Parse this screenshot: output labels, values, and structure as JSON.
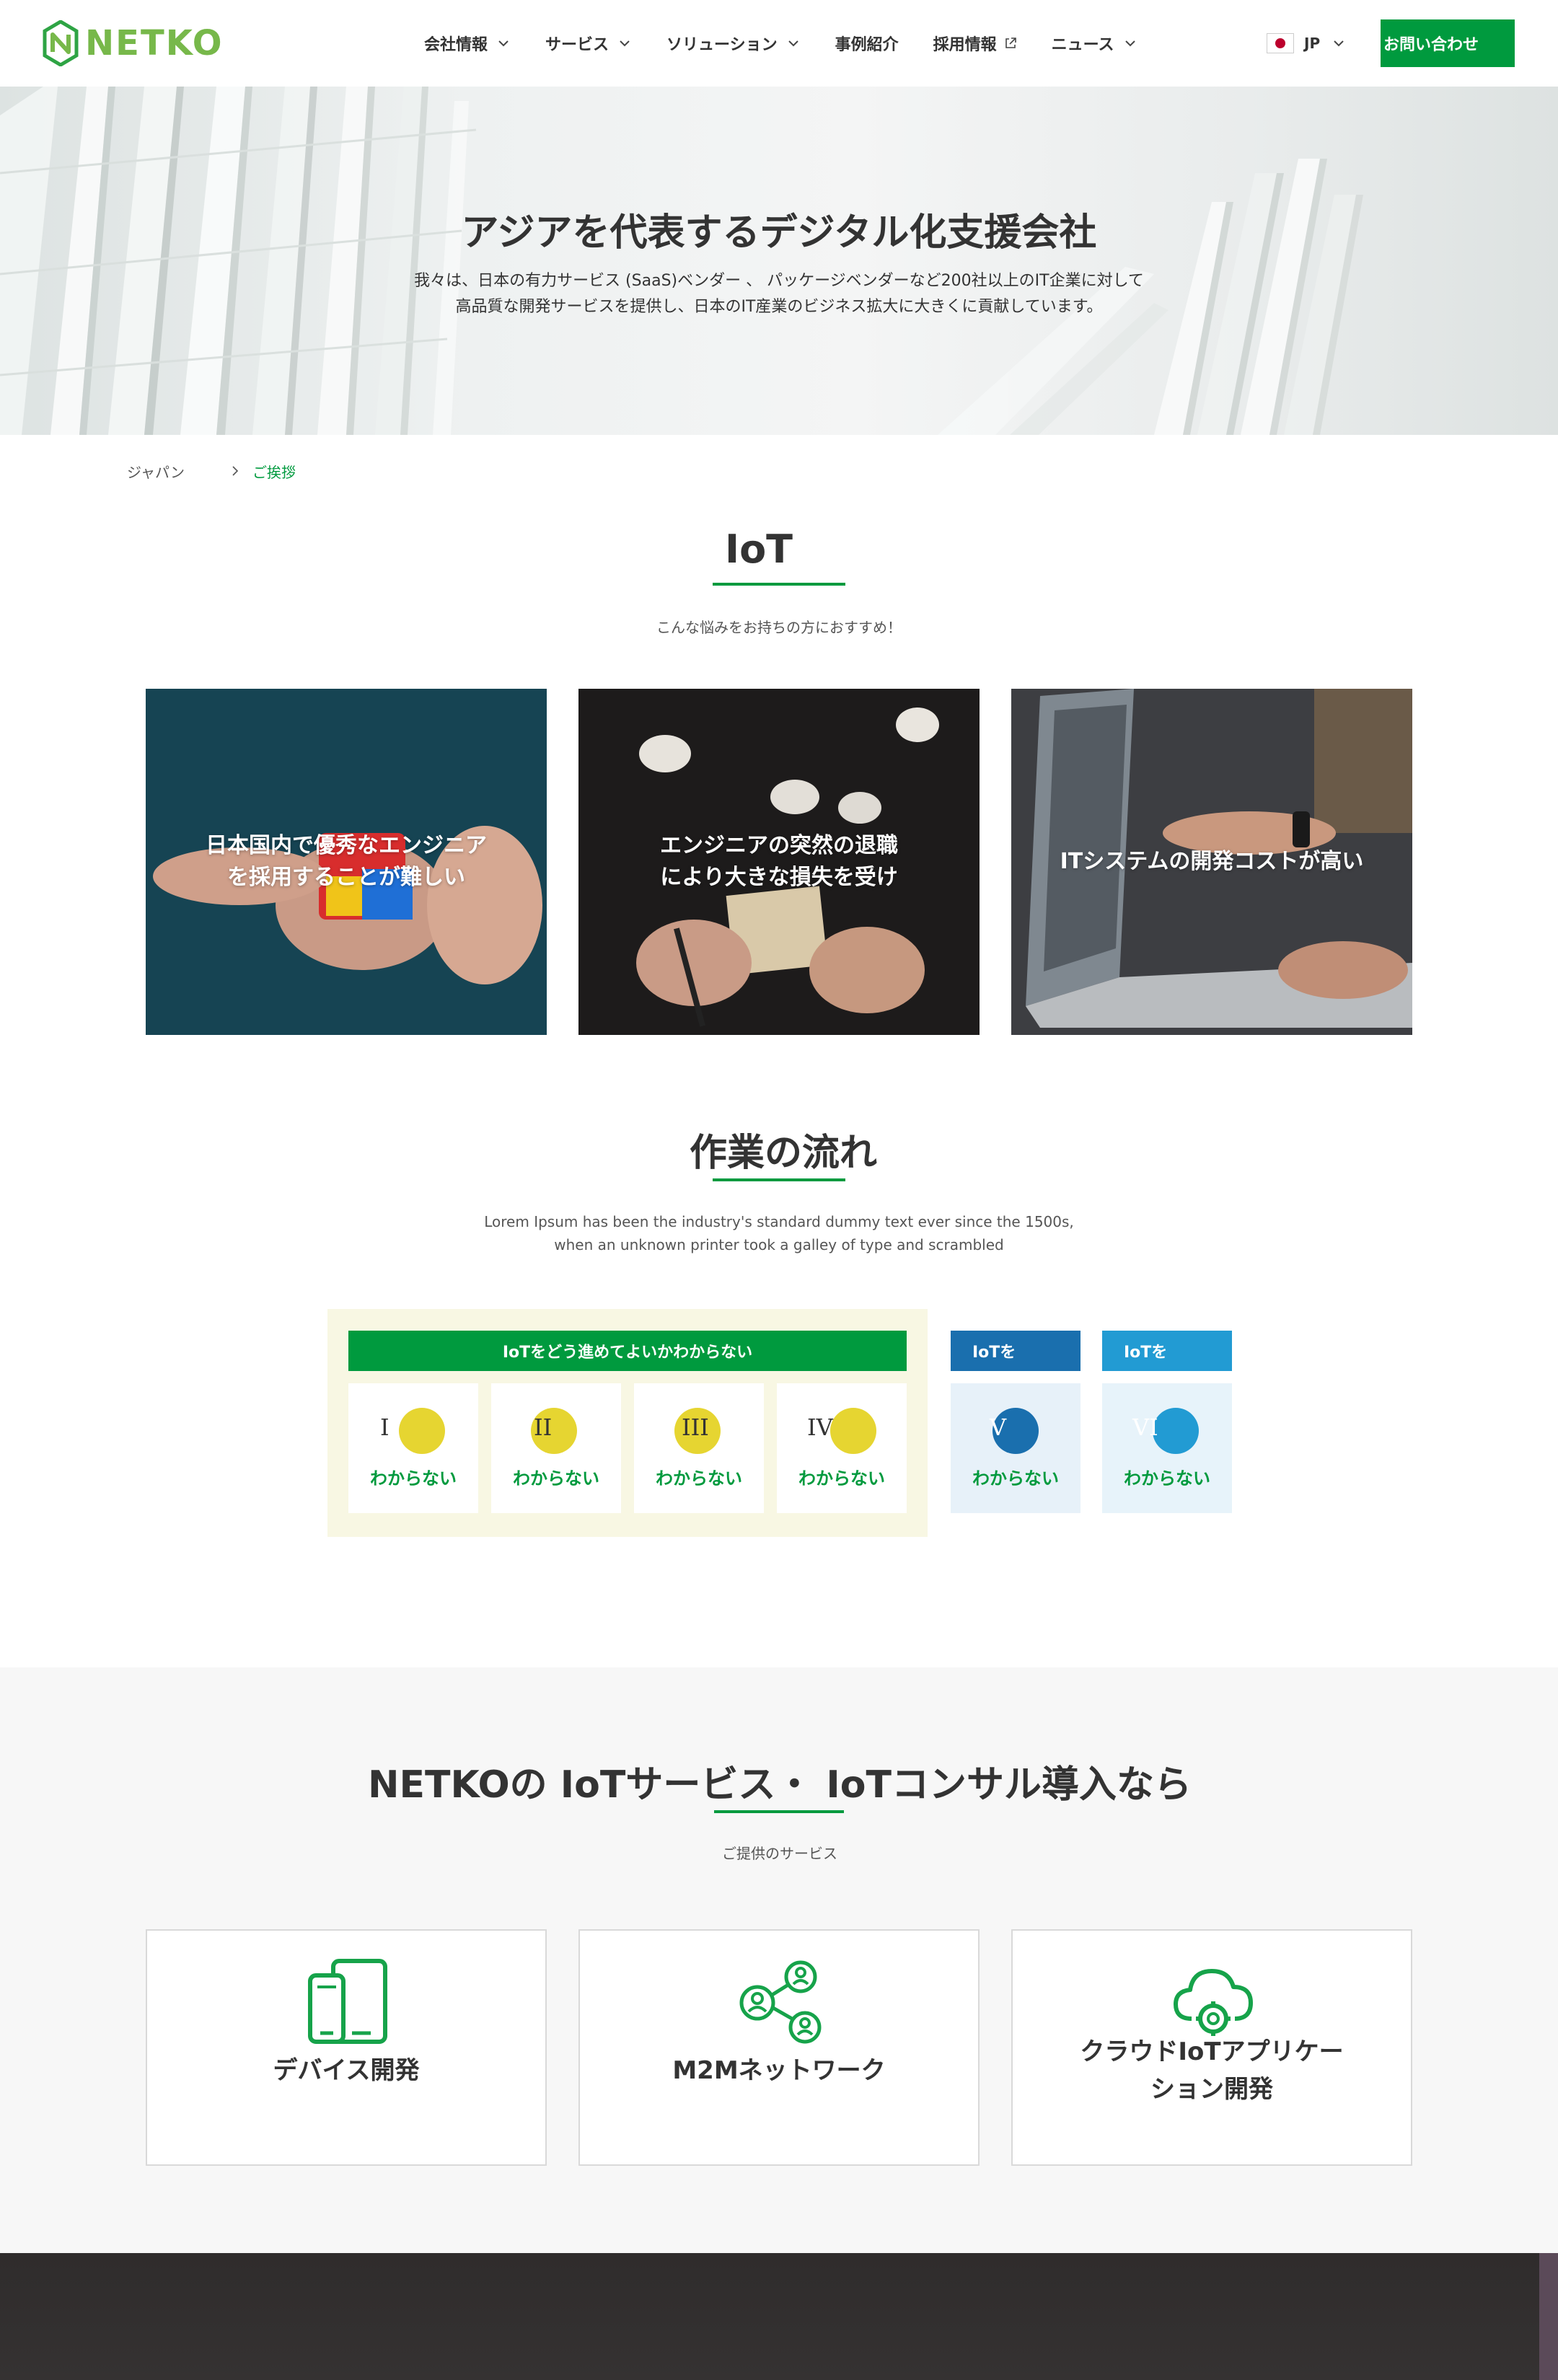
{
  "header": {
    "logo_text": "NETKO",
    "nav": [
      {
        "label": "会社情報",
        "has_dropdown": true
      },
      {
        "label": "サービス",
        "has_dropdown": true
      },
      {
        "label": "ソリューション",
        "has_dropdown": true
      },
      {
        "label": "事例紹介",
        "has_dropdown": false
      },
      {
        "label": "採用情報",
        "external": true
      },
      {
        "label": "ニュース",
        "has_dropdown": true
      }
    ],
    "lang_label": "JP",
    "contact_label": "お問い合わせ"
  },
  "hero": {
    "title": "アジアを代表するデジタル化支援会社",
    "desc_line1": "我々は、日本の有力サービス (SaaS)ベンダー 、 パッケージベンダーなど200社以上のIT企業に対して",
    "desc_line2": "高品質な開発サービスを提供し、日本のIT産業のビジネス拡大に大きくに貢献しています。"
  },
  "breadcrumb": {
    "home": "ジャパン",
    "current": "ご挨拶"
  },
  "iot": {
    "title": "IoT",
    "subtitle": "こんな悩みをお持ちの方におすすめ！",
    "cards": [
      {
        "text": "日本国内で優秀なエンジニア\nを採用することが難しい"
      },
      {
        "text": "エンジニアの突然の退職\nにより大きな損失を受け"
      },
      {
        "text": "ITシステムの開発コストが高い"
      }
    ]
  },
  "flow": {
    "title": "作業の流れ",
    "desc_line1": "Lorem Ipsum has been the industry's standard dummy text ever since the 1500s,",
    "desc_line2": "when an unknown printer took a galley of type and scrambled",
    "group_header": "IoTをどう進めてよいかわからない",
    "header_5": "IoTを",
    "header_6": "IoTを",
    "steps": [
      {
        "num": "I",
        "label": "わからない"
      },
      {
        "num": "II",
        "label": "わからない"
      },
      {
        "num": "III",
        "label": "わからない"
      },
      {
        "num": "IV",
        "label": "わからない"
      },
      {
        "num": "V",
        "label": "わからない"
      },
      {
        "num": "VI",
        "label": "わからない"
      }
    ],
    "colors": {
      "green": "#009a3e",
      "yellow": "#e6d531",
      "blue": "#1a6fae",
      "lightblue": "#229bd3"
    }
  },
  "services": {
    "title": "NETKOの IoTサービス・ IoTコンサル導入なら",
    "subtitle": "ご提供のサービス",
    "cards": [
      {
        "icon": "devices-icon",
        "label": "デバイス開発"
      },
      {
        "icon": "network-icon",
        "label": "M2Mネットワーク"
      },
      {
        "icon": "cloud-gear-icon",
        "label": "クラウドIoTアプリケー\nション開発"
      }
    ]
  }
}
